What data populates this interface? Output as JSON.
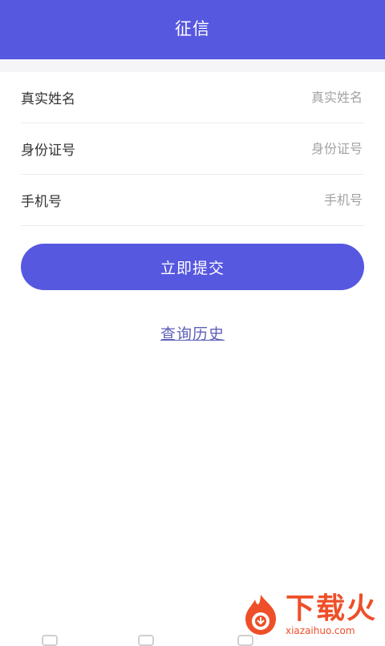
{
  "header": {
    "title": "征信"
  },
  "form": {
    "fields": [
      {
        "label": "真实姓名",
        "placeholder": "真实姓名"
      },
      {
        "label": "身份证号",
        "placeholder": "身份证号"
      },
      {
        "label": "手机号",
        "placeholder": "手机号"
      }
    ],
    "submit_label": "立即提交",
    "history_label": "查询历史"
  },
  "watermark": {
    "logo": "flame-logo-icon",
    "name": "下载火",
    "domain": "xiazaihuo.com"
  },
  "colors": {
    "primary": "#5758e0",
    "link": "#5f5fb8",
    "watermark": "#ee4f28"
  }
}
